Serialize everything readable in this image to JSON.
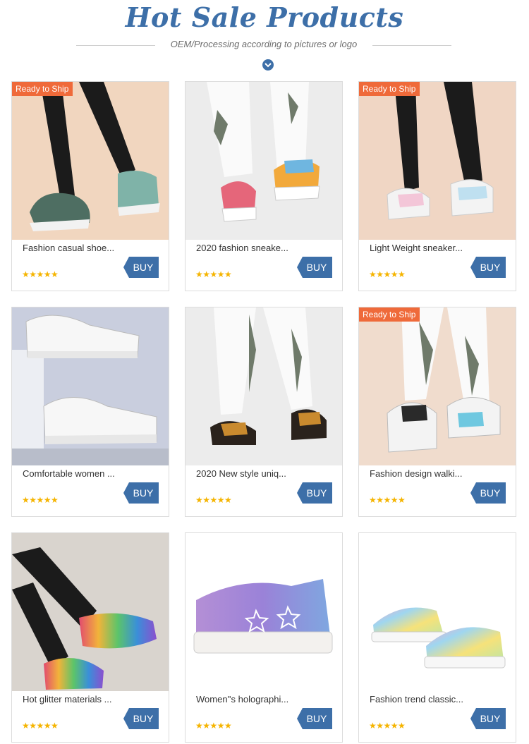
{
  "header": {
    "title": "Hot Sale Products",
    "subtitle": "OEM/Processing according to pictures or logo"
  },
  "colors": {
    "accent": "#3d6fa8",
    "badge": "#ef6a3a",
    "star": "#f5b400"
  },
  "products": [
    {
      "name": "Fashion casual shoe...",
      "badge": "Ready to Ship",
      "buy": "BUY",
      "stars": "★★★★★",
      "rating": 5
    },
    {
      "name": "2020 fashion sneake...",
      "badge": "",
      "buy": "BUY",
      "stars": "★★★★★",
      "rating": 5
    },
    {
      "name": "Light Weight sneaker...",
      "badge": "Ready to Ship",
      "buy": "BUY",
      "stars": "★★★★★",
      "rating": 5
    },
    {
      "name": "Comfortable women ...",
      "badge": "",
      "buy": "BUY",
      "stars": "★★★★★",
      "rating": 5
    },
    {
      "name": "2020 New style uniq...",
      "badge": "",
      "buy": "BUY",
      "stars": "★★★★★",
      "rating": 5
    },
    {
      "name": "Fashion design walki...",
      "badge": "Ready to Ship",
      "buy": "BUY",
      "stars": "★★★★★",
      "rating": 5
    },
    {
      "name": "Hot glitter materials ...",
      "badge": "",
      "buy": "BUY",
      "stars": "★★★★★",
      "rating": 5
    },
    {
      "name": "Women''s holographi...",
      "badge": "",
      "buy": "BUY",
      "stars": "★★★★★",
      "rating": 5
    },
    {
      "name": "Fashion trend classic...",
      "badge": "",
      "buy": "BUY",
      "stars": "★★★★★",
      "rating": 5
    }
  ]
}
